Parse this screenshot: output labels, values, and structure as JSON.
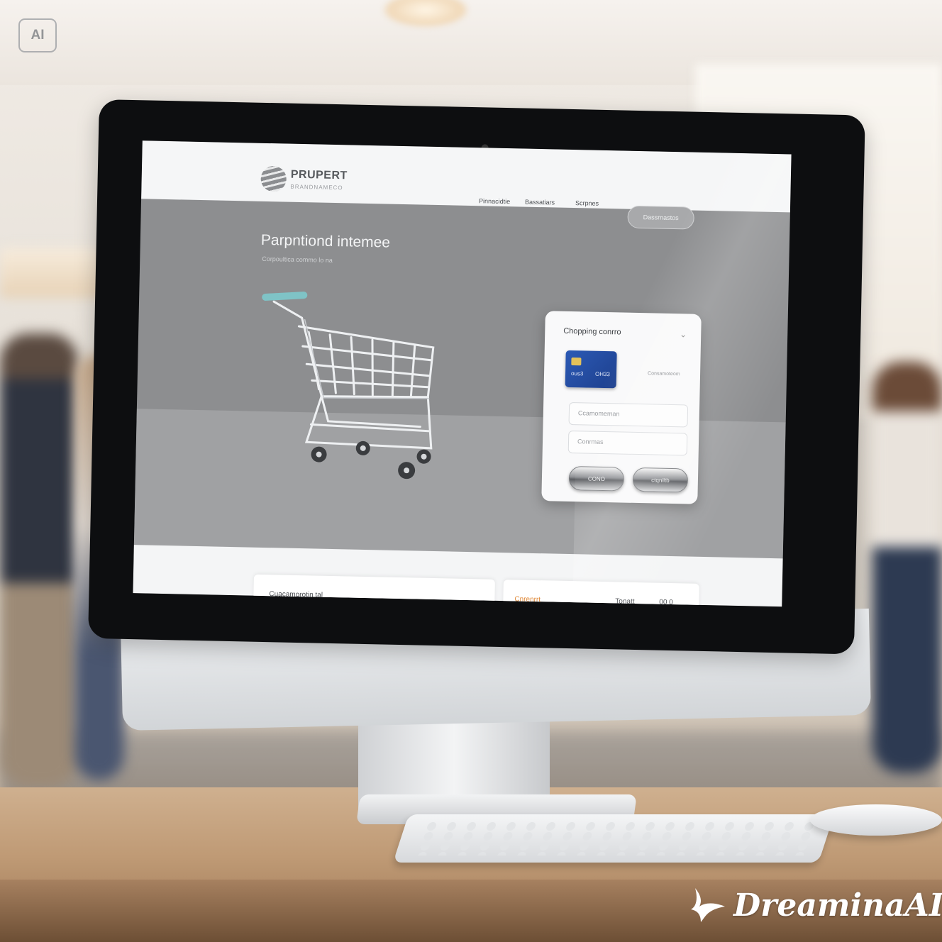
{
  "badge": "AI",
  "watermark": "DreaminaAI",
  "site": {
    "brand": "PRUPERT",
    "brand_tagline": "BRANDNAMECO",
    "nav_links": [
      "Pinnacidtie",
      "Bassatiars",
      "Scrpnes"
    ],
    "nav_button": "Dassrnastos"
  },
  "hero": {
    "title": "Parpntiond intemee",
    "subtitle": "Corpoultica commo lo na"
  },
  "checkout": {
    "title": "Chopping conrro",
    "card_number_left": "ous3",
    "card_number_right": "OH33",
    "card_side_label": "Consamoteom",
    "field1_placeholder": "Ccamomeman",
    "field2_placeholder": "Conrmas",
    "button_left": "CONO",
    "button_right": "ctqniltb"
  },
  "bottom": {
    "card_left": "Cuacamorotin tal",
    "card_right_a": "Cnrenrrt",
    "card_right_b": "Tonatt",
    "card_right_c": "00 0"
  },
  "colors": {
    "accent_orange": "#e08a3a",
    "card_blue": "#2c5ab5",
    "cart_handle": "#7fc3c6"
  }
}
